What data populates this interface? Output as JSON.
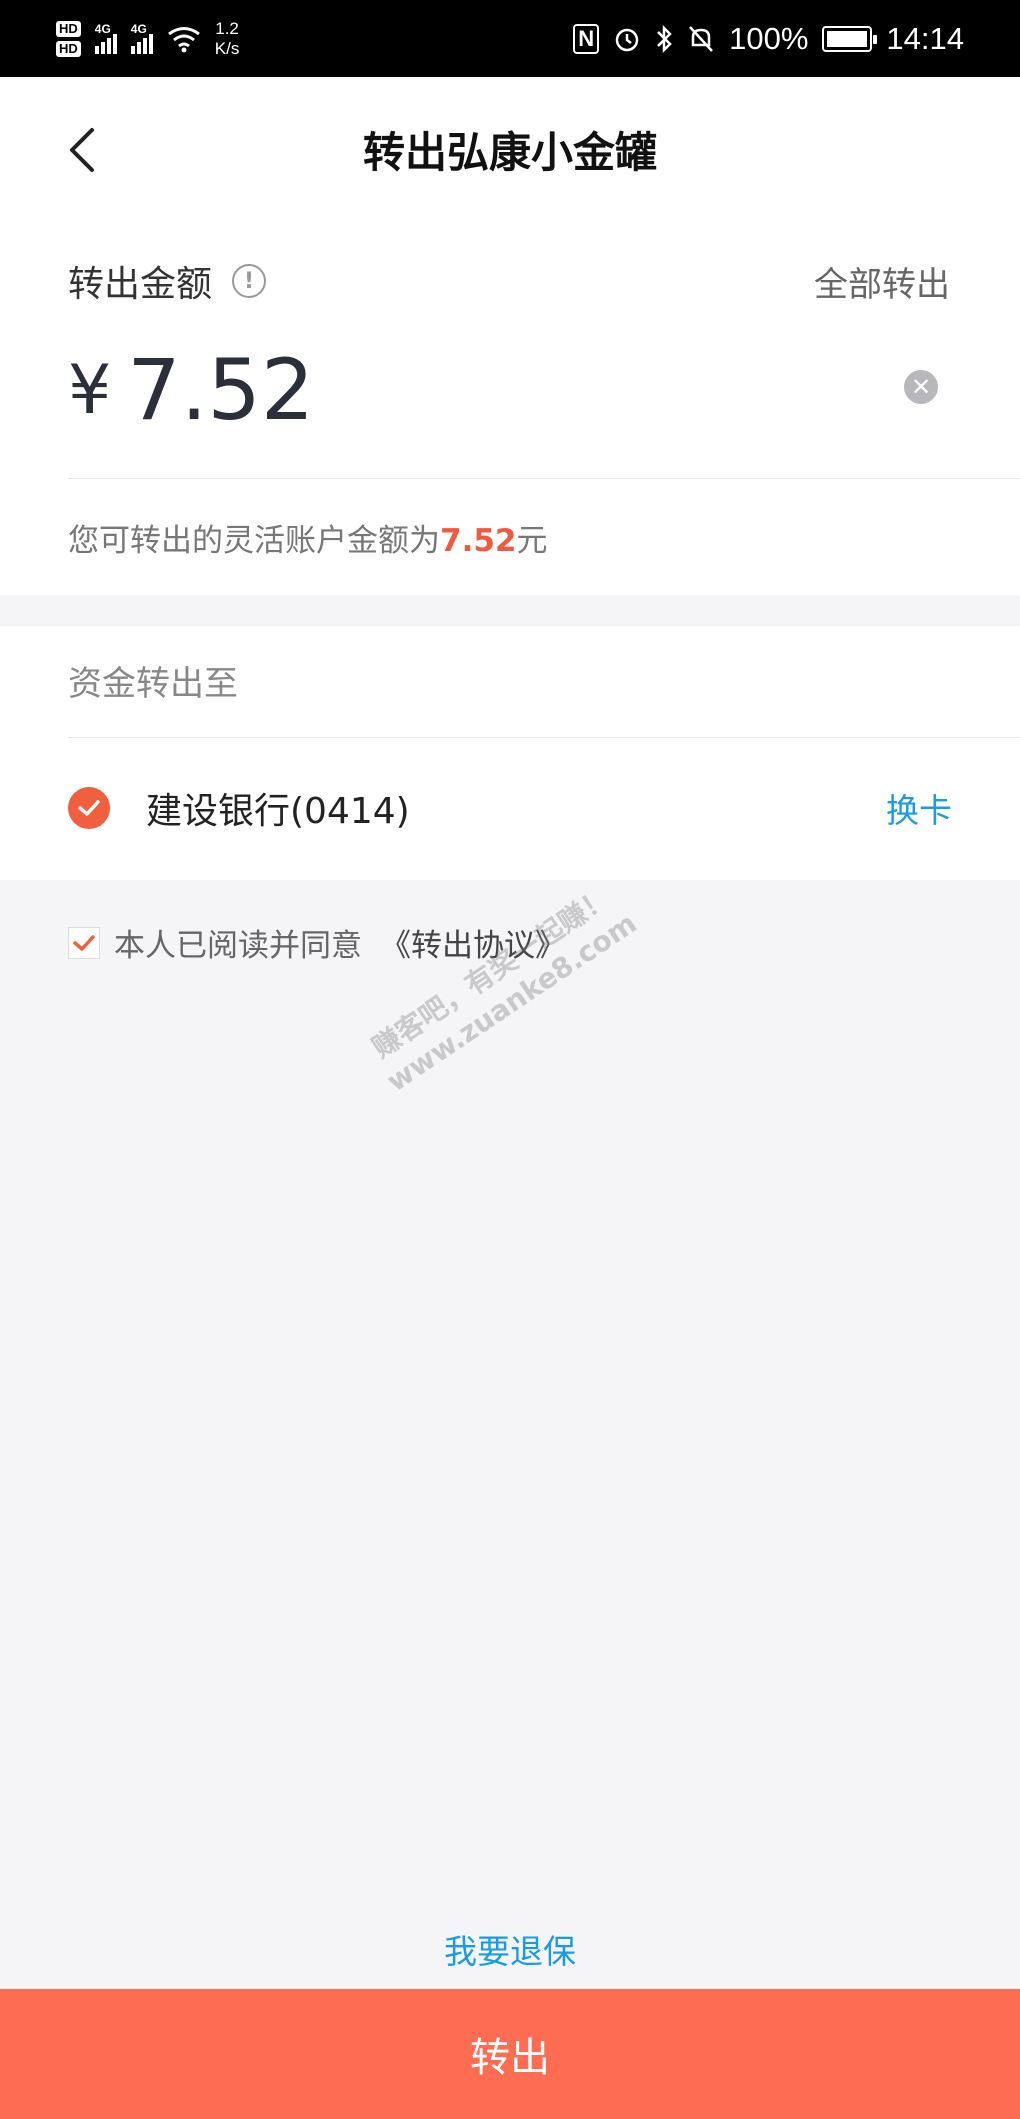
{
  "status_bar": {
    "hd1": "HD",
    "hd2": "HD",
    "net1": "4G",
    "net2": "4G",
    "speed_value": "1.2",
    "speed_unit": "K/s",
    "nfc": "N",
    "battery": "100%",
    "time": "14:14"
  },
  "header": {
    "title": "转出弘康小金罐"
  },
  "amount": {
    "label": "转出金额",
    "all_out": "全部转出",
    "currency": "¥",
    "value": "7.52",
    "available_prefix": "您可转出的灵活账户金额为",
    "available_amount": "7.52",
    "available_suffix": "元"
  },
  "transfer": {
    "label": "资金转出至",
    "bank": "建设银行(0414)",
    "change_card": "换卡"
  },
  "agreement": {
    "text": "本人已阅读并同意",
    "link": "《转出协议》",
    "checked": true
  },
  "watermark": {
    "line1": "赚客吧，有奖一起赚！",
    "line2": "www.zuanke8.com"
  },
  "surrender_link": "我要退保",
  "submit_button": "转出",
  "colors": {
    "accent": "#fe6c51",
    "link": "#1a9be6",
    "highlight": "#f05a41"
  }
}
